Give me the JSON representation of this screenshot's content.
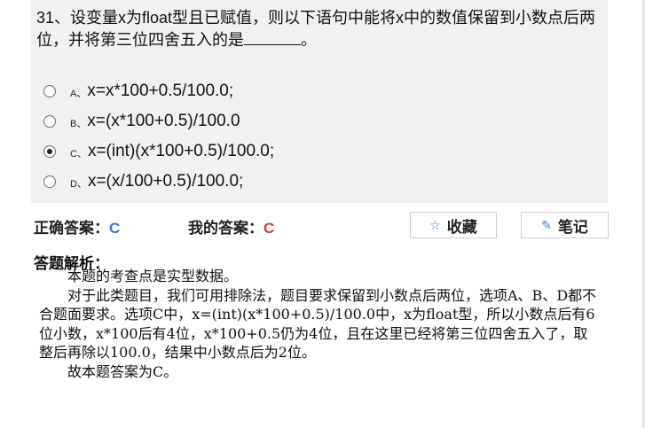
{
  "question": {
    "text": "31、设变量x为float型且已赋值，则以下语句中能将x中的数值保留到小数点后两位，并将第三位四舍五入的是",
    "tail": "。"
  },
  "options": [
    {
      "letter": "A、",
      "text": "x=x*100+0.5/100.0;",
      "checked": false
    },
    {
      "letter": "B、",
      "text": "x=(x*100+0.5)/100.0",
      "checked": false
    },
    {
      "letter": "C、",
      "text": "x=(int)(x*100+0.5)/100.0;",
      "checked": true
    },
    {
      "letter": "D、",
      "text": "x=(x/100+0.5)/100.0;",
      "checked": false
    }
  ],
  "answers": {
    "correct_label": "正确答案：",
    "correct_value": "C",
    "mine_label": "我的答案：",
    "mine_value": "C"
  },
  "buttons": {
    "favorite_label": "收藏",
    "favorite_icon": "star-icon",
    "note_label": "笔记",
    "note_icon": "pencil-icon"
  },
  "analysis": {
    "title": "答题解析：",
    "paragraphs": [
      "本题的考查点是实型数据。",
      "对于此类题目，我们可用排除法，题目要求保留到小数点后两位，选项A、B、D都不合题面要求。选项C中，x=(int)(x*100+0.5)/100.0中，x为float型，所以小数点后有6位小数，x*100后有4位，x*100+0.5仍为4位，且在这里已经将第三位四舍五入了，取整后再除以100.0，结果中小数点后为2位。",
      "故本题答案为C。"
    ]
  },
  "colors": {
    "correct": "#2f7be0",
    "mine": "#d63a2e",
    "question_bg": "#f1f1f1"
  }
}
